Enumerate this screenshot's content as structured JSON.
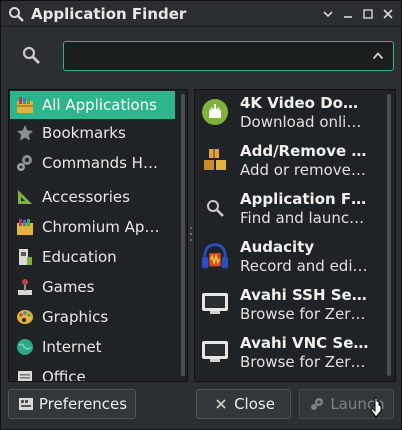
{
  "window": {
    "title": "Application Finder"
  },
  "search": {
    "value": "",
    "placeholder": ""
  },
  "categories": [
    {
      "label": "All Applications",
      "icon": "all-applications-icon",
      "selected": true
    },
    {
      "label": "Bookmarks",
      "icon": "star-icon"
    },
    {
      "label": "Commands H…",
      "icon": "gears-icon"
    },
    {
      "label": "Accessories",
      "icon": "set-square-icon"
    },
    {
      "label": "Chromium Ap…",
      "icon": "applications-icon"
    },
    {
      "label": "Education",
      "icon": "education-icon"
    },
    {
      "label": "Games",
      "icon": "joystick-icon"
    },
    {
      "label": "Graphics",
      "icon": "palette-icon"
    },
    {
      "label": "Internet",
      "icon": "globe-icon"
    },
    {
      "label": "Office",
      "icon": "office-icon"
    }
  ],
  "apps": [
    {
      "name": "4K Video Do…",
      "desc": "Download onli…",
      "icon": "video-downloader-icon"
    },
    {
      "name": "Add/Remove …",
      "desc": "Add or remove…",
      "icon": "packages-icon"
    },
    {
      "name": "Application F…",
      "desc": "Find and launc…",
      "icon": "search-icon"
    },
    {
      "name": "Audacity",
      "desc": "Record and edi…",
      "icon": "audacity-headphones-icon"
    },
    {
      "name": "Avahi SSH Se…",
      "desc": "Browse for Zer…",
      "icon": "monitor-icon"
    },
    {
      "name": "Avahi VNC Se…",
      "desc": "Browse for Zer…",
      "icon": "monitor-icon"
    }
  ],
  "buttons": {
    "preferences": "Preferences",
    "close": "Close",
    "launch": "Launch"
  },
  "colors": {
    "accent": "#2db58e",
    "background": "#2b2f31",
    "panel": "#202325"
  }
}
